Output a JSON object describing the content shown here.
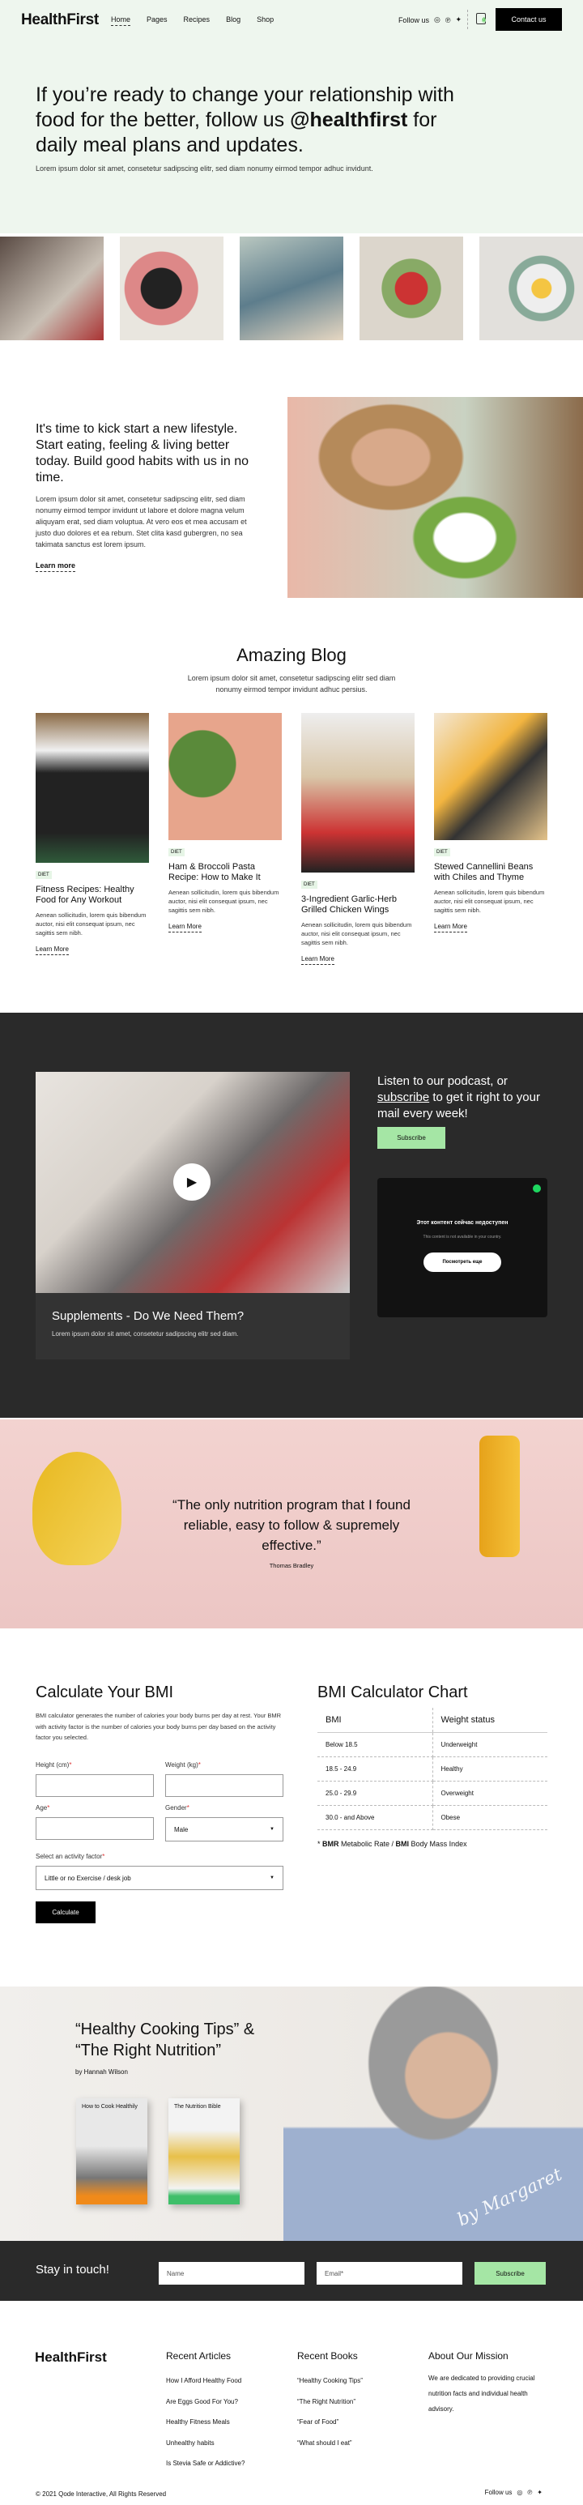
{
  "header": {
    "logo": "HealthFirst",
    "nav": [
      "Home",
      "Pages",
      "Recipes",
      "Blog",
      "Shop"
    ],
    "follow_label": "Follow us",
    "cart_count": "0",
    "contact_label": "Contact us"
  },
  "hero": {
    "heading_pre": "If you’re ready to change your relationship with food for the better, follow us ",
    "heading_handle": "@healthfirst",
    "heading_post": " for daily meal plans and updates.",
    "text": "Lorem ipsum dolor sit amet, consetetur sadipscing elitr, sed diam nonumy eirmod tempor adhuc invidunt."
  },
  "intro": {
    "heading": "It's time to kick start a new lifestyle. Start eating, feeling & living better today. Build good habits with us in no time.",
    "text": "Lorem ipsum dolor sit amet, consetetur sadipscing elitr, sed diam nonumy eirmod tempor invidunt ut labore et dolore magna velum aliquyam erat, sed diam voluptua. At vero eos et mea accusam et justo duo dolores et ea rebum. Stet clita kasd gubergren, no sea takimata sanctus est lorem ipsum.",
    "link": "Learn more"
  },
  "blog": {
    "title": "Amazing Blog",
    "subtitle": "Lorem ipsum dolor sit amet, consetetur sadipscing elitr sed diam nonumy eirmod tempor invidunt adhuc persius.",
    "cards": [
      {
        "tag": "DIET",
        "title": "Fitness Recipes: Healthy Food for Any Workout",
        "text": "Aenean sollicitudin, lorem quis bibendum auctor, nisi elit consequat ipsum, nec sagittis sem nibh.",
        "link": "Learn More"
      },
      {
        "tag": "DIET",
        "title": "Ham & Broccoli Pasta Recipe: How to Make It",
        "text": "Aenean sollicitudin, lorem quis bibendum auctor, nisi elit consequat ipsum, nec sagittis sem nibh.",
        "link": "Learn More"
      },
      {
        "tag": "DIET",
        "title": "3-Ingredient Garlic-Herb Grilled Chicken Wings",
        "text": "Aenean sollicitudin, lorem quis bibendum auctor, nisi elit consequat ipsum, nec sagittis sem nibh.",
        "link": "Learn More"
      },
      {
        "tag": "DIET",
        "title": "Stewed Cannellini Beans with Chiles and Thyme",
        "text": "Aenean sollicitudin, lorem quis bibendum auctor, nisi elit consequat ipsum, nec sagittis sem nibh.",
        "link": "Learn More"
      }
    ]
  },
  "podcast": {
    "video_title": "Supplements - Do We Need Them?",
    "video_text": "Lorem ipsum dolor sit amet, consetetur sadipscing elitr sed diam.",
    "heading_pre": "Listen to our podcast, or ",
    "heading_link": "subscribe",
    "heading_post": " to get it right to your mail every week!",
    "subscribe_label": "Subscribe",
    "embed": {
      "title": "Этот контент сейчас недоступен",
      "text": "This content is not available in your country.",
      "button": "Посмотреть еще"
    }
  },
  "testimonial": {
    "quote": "“The only nutrition program that I found reliable, easy to follow & supremely effective.”",
    "author": "Thomas Bradley"
  },
  "bmi": {
    "title": "Calculate Your BMI",
    "text": "BMI calculator generates the number of calories your body burns per day at rest. Your BMR with activity factor is the number of calories your body burns per day based on the activity factor you selected.",
    "height_label": "Height (cm)",
    "weight_label": "Weight (kg)",
    "age_label": "Age",
    "gender_label": "Gender",
    "gender_value": "Male",
    "activity_label": "Select an activity factor",
    "activity_value": "Little or no Exercise / desk job",
    "required": "*",
    "calculate": "Calculate"
  },
  "bmi_chart": {
    "title": "BMI Calculator Chart",
    "headers": [
      "BMI",
      "Weight status"
    ],
    "rows": [
      [
        "Below 18.5",
        "Underweight"
      ],
      [
        "18.5 - 24.9",
        "Healthy"
      ],
      [
        "25.0 - 29.9",
        "Overweight"
      ],
      [
        "30.0 - and Above",
        "Obese"
      ]
    ],
    "note_pre": "* ",
    "note_bmr": "BMR",
    "note_mid": " Metabolic Rate / ",
    "note_bmi": "BMI",
    "note_post": " Body Mass Index"
  },
  "books": {
    "title": "“Healthy Cooking Tips” & “The Right Nutrition”",
    "author": "by Hannah Wilson",
    "book1": "How to Cook Healthily",
    "book2": "The Nutrition Bible",
    "signature": "by Margaret"
  },
  "newsletter": {
    "title": "Stay in touch!",
    "name_placeholder": "Name",
    "email_placeholder": "Email*",
    "button": "Subscribe"
  },
  "footer": {
    "logo": "HealthFirst",
    "articles": {
      "title": "Recent Articles",
      "items": [
        "How I Afford Healthy Food",
        "Are Eggs Good For You?",
        "Healthy Fitness Meals",
        "Unhealthy habits",
        "Is Stevia Safe or Addictive?"
      ]
    },
    "books": {
      "title": "Recent Books",
      "items": [
        "“Healthy Cooking Tips”",
        "“The Right Nutrition”",
        "“Fear of Food”",
        "“What should I eat”"
      ]
    },
    "mission": {
      "title": "About Our Mission",
      "text": "We are dedicated to providing crucial nutrition facts and individual health advisory."
    },
    "copyright": "© 2021 Qode Interactive, All Rights Reserved",
    "follow_label": "Follow us"
  },
  "colors": {
    "accent_green": "#a5e6a5",
    "hero_bg": "#eef6ee",
    "dark": "#2a2a2a",
    "pink": "#f0cfcc"
  }
}
